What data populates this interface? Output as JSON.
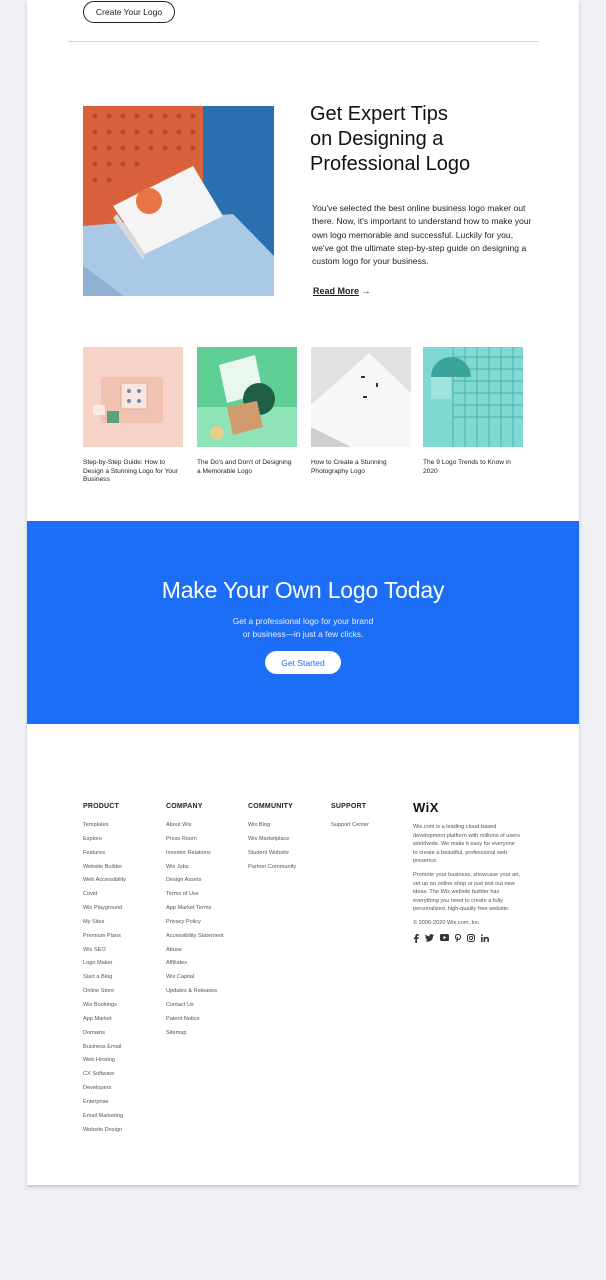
{
  "top_button": "Create Your Logo",
  "hero": {
    "title_lines": [
      "Get Expert Tips",
      "on Designing a",
      "Professional Logo"
    ],
    "text": "You've selected the best online business logo maker out there. Now, it's important to understand how to make your own logo memorable and successful. Luckily for you, we've got the ultimate step-by-step guide on designing a custom logo for your business.",
    "read_more": "Read More",
    "arrow": "→"
  },
  "articles": [
    {
      "caption": "Step-by-Step Guide: How to Design a Stunning Logo for Your Business"
    },
    {
      "caption": "The Do's and Don't of Designing a Memorable Logo"
    },
    {
      "caption": "How to Create a Stunning Photography Logo"
    },
    {
      "caption": "The 9 Logo Trends to Know in 2020"
    }
  ],
  "cta": {
    "title": "Make Your Own Logo Today",
    "sub_line1": "Get a professional logo for your brand",
    "sub_line2": "or business—in just a few clicks.",
    "button": "Get Started"
  },
  "footer": {
    "product": {
      "heading": "PRODUCT",
      "links": [
        "Templates",
        "Explore",
        "Features",
        "Website Builder",
        "Web Accessibility",
        "Covid",
        "Wix Playground",
        "My Sites",
        "Premium Plans",
        "Wix SEO",
        "Logo Maker",
        "Start a Blog",
        "Online Store",
        "Wix Bookings",
        "App Market",
        "Domains",
        "Business Email",
        "Web Hosting",
        "CX Software",
        "Developers",
        "Enterprise",
        "Email Marketing",
        "Website Design"
      ]
    },
    "company": {
      "heading": "COMPANY",
      "links": [
        "About Wix",
        "Press Room",
        "Investor Relations",
        "Wix Jobs",
        "Design Assets",
        "Terms of Use",
        "App Market Terms",
        "Privacy Policy",
        "Accessibility Statement",
        "Abuse",
        "Affiliates",
        "Wix Capital",
        "Updates & Releases",
        "Contact Us",
        "Patent Notice",
        "Sitemap"
      ]
    },
    "community": {
      "heading": "COMMUNITY",
      "links": [
        "Wix Blog",
        "Wix Marketplace",
        "Student Website",
        "Partner Community"
      ]
    },
    "support": {
      "heading": "SUPPORT",
      "links": [
        "Support Center"
      ]
    },
    "about": {
      "logo": "WiX",
      "para1": "Wix.com is a leading cloud-based development platform with millions of users worldwide. We make it easy for everyone to create a beautiful, professional web presence.",
      "para2": "Promote your business, showcase your art, set up an online shop or just test out new ideas. The Wix website builder has everything you need to create a fully personalized, high-quality free website.",
      "copyright": "© 2006-2020 Wix.com, Inc"
    },
    "social_icons": [
      "facebook-icon",
      "twitter-icon",
      "youtube-icon",
      "pinterest-icon",
      "instagram-icon",
      "linkedin-icon"
    ]
  }
}
